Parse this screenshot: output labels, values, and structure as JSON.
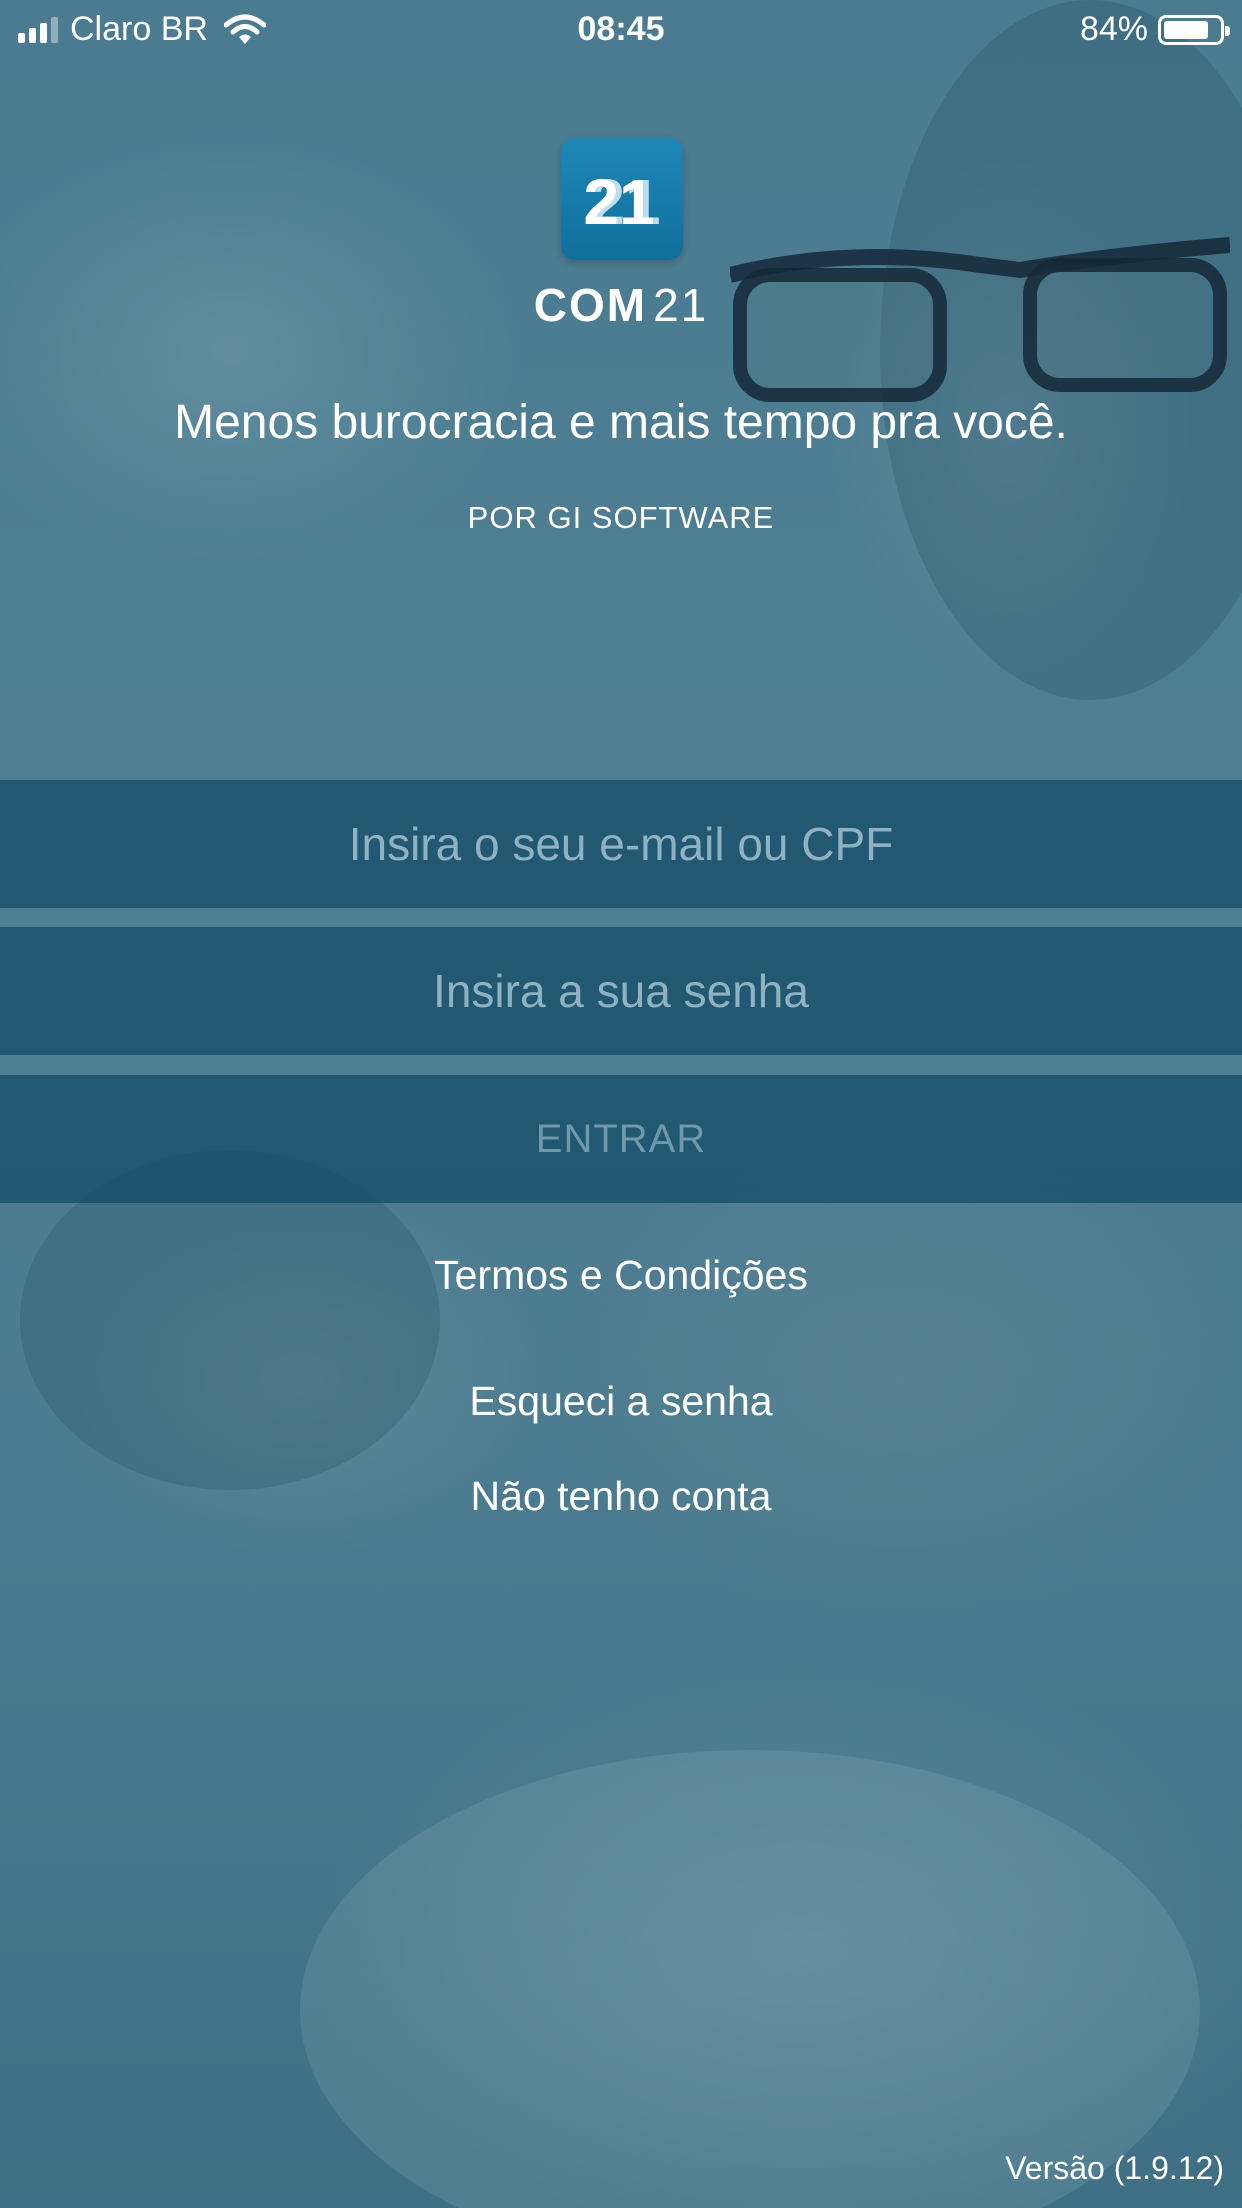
{
  "status_bar": {
    "carrier": "Claro BR",
    "time": "08:45",
    "battery_percent_label": "84%",
    "battery_level": 0.84,
    "signal_bars_active": 3,
    "signal_bars_total": 4
  },
  "logo": {
    "icon_text": "21",
    "brand_bold": "COM",
    "brand_light": "21"
  },
  "header": {
    "tagline": "Menos burocracia e mais tempo pra você.",
    "byline": "POR GI SOFTWARE"
  },
  "form": {
    "email_placeholder": "Insira o seu e-mail ou CPF",
    "email_value": "",
    "password_placeholder": "Insira a sua senha",
    "password_value": "",
    "login_label": "ENTRAR"
  },
  "links": {
    "terms": "Termos e Condições",
    "forgot_password": "Esqueci a senha",
    "no_account": "Não tenho conta"
  },
  "footer": {
    "version": "Versão (1.9.12)"
  },
  "colors": {
    "overlay": "#4f7f93",
    "field_background": "#114a65",
    "placeholder": "#8fb2c2",
    "logo_blue": "#1d88b7"
  }
}
